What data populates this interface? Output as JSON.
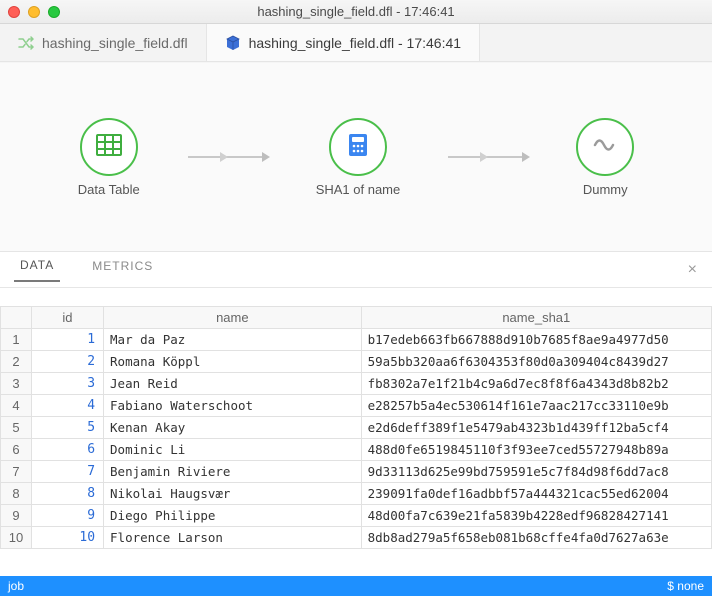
{
  "window": {
    "title": "hashing_single_field.dfl - 17:46:41"
  },
  "tabs": [
    {
      "label": "hashing_single_field.dfl",
      "icon": "shuffle-icon",
      "active": false
    },
    {
      "label": "hashing_single_field.dfl - 17:46:41",
      "icon": "cube-icon",
      "active": true
    }
  ],
  "flow": {
    "nodes": [
      {
        "label": "Data Table",
        "icon": "table-icon",
        "accent": "#4abf4a"
      },
      {
        "label": "SHA1 of name",
        "icon": "calculator-icon",
        "accent": "#3b86f0"
      },
      {
        "label": "Dummy",
        "icon": "wave-icon",
        "accent": "#9b9b9b"
      }
    ]
  },
  "subtabs": {
    "items": [
      {
        "label": "DATA",
        "active": true
      },
      {
        "label": "METRICS",
        "active": false
      }
    ],
    "close": "×"
  },
  "table": {
    "columns": [
      "id",
      "name",
      "name_sha1"
    ],
    "rows": [
      {
        "n": 1,
        "id": 1,
        "name": "Mar da Paz",
        "name_sha1": "b17edeb663fb667888d910b7685f8ae9a4977d50"
      },
      {
        "n": 2,
        "id": 2,
        "name": "Romana Köppl",
        "name_sha1": "59a5bb320aa6f6304353f80d0a309404c8439d27"
      },
      {
        "n": 3,
        "id": 3,
        "name": "Jean Reid",
        "name_sha1": "fb8302a7e1f21b4c9a6d7ec8f8f6a4343d8b82b2"
      },
      {
        "n": 4,
        "id": 4,
        "name": "Fabiano Waterschoot",
        "name_sha1": "e28257b5a4ec530614f161e7aac217cc33110e9b"
      },
      {
        "n": 5,
        "id": 5,
        "name": "Kenan Akay",
        "name_sha1": "e2d6deff389f1e5479ab4323b1d439ff12ba5cf4"
      },
      {
        "n": 6,
        "id": 6,
        "name": "Dominic Li",
        "name_sha1": "488d0fe6519845110f3f93ee7ced55727948b89a"
      },
      {
        "n": 7,
        "id": 7,
        "name": "Benjamin Riviere",
        "name_sha1": "9d33113d625e99bd759591e5c7f84d98f6dd7ac8"
      },
      {
        "n": 8,
        "id": 8,
        "name": "Nikolai Haugsvær",
        "name_sha1": "239091fa0def16adbbf57a444321cac55ed62004"
      },
      {
        "n": 9,
        "id": 9,
        "name": "Diego Philippe",
        "name_sha1": "48d00fa7c639e21fa5839b4228edf96828427141"
      },
      {
        "n": 10,
        "id": 10,
        "name": "Florence Larson",
        "name_sha1": "8db8ad279a5f658eb081b68cffe4fa0d7627a63e"
      }
    ]
  },
  "status": {
    "left": "job",
    "right": "$ none"
  }
}
